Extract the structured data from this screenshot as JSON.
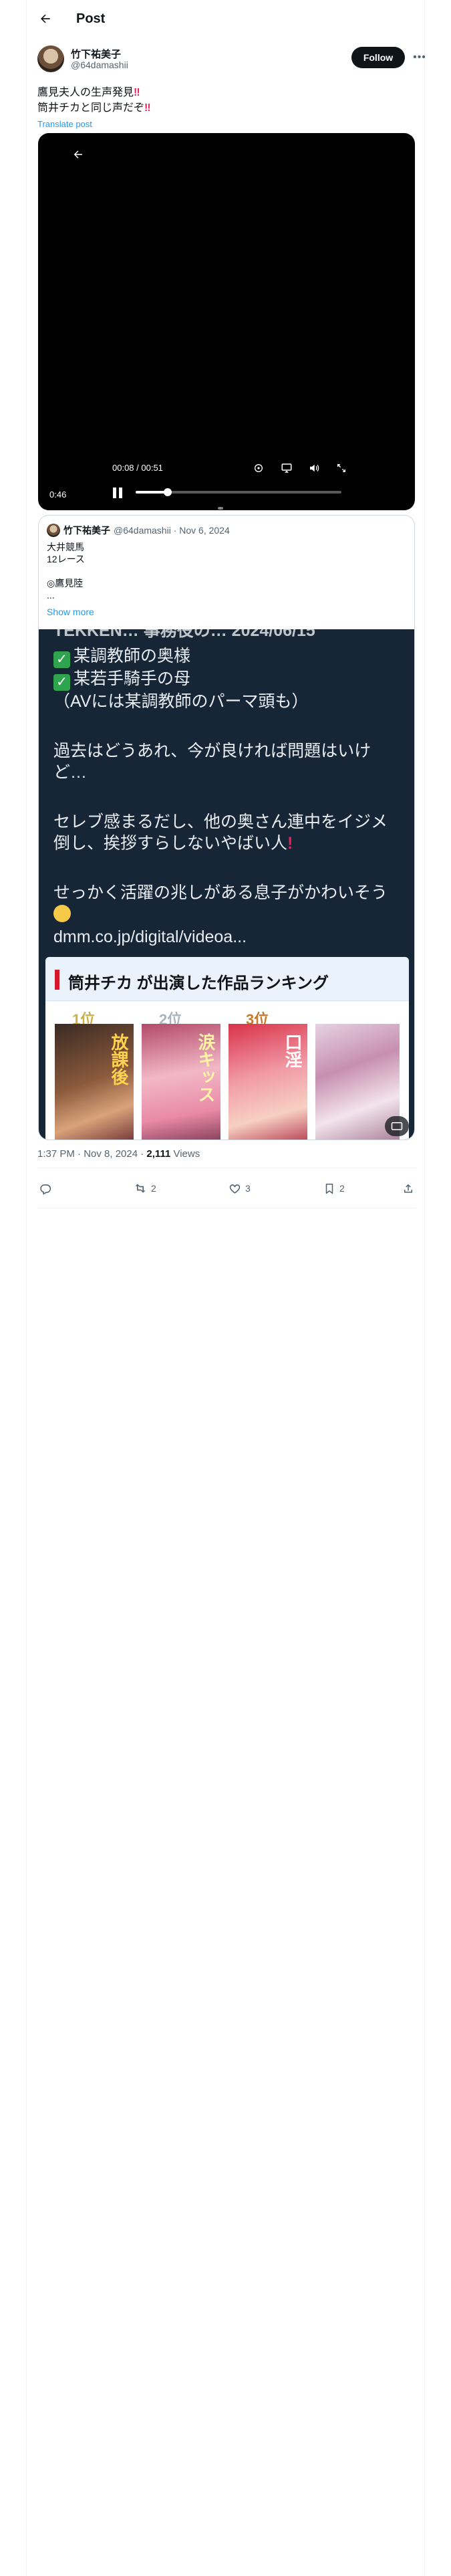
{
  "header": {
    "title": "Post"
  },
  "author": {
    "name": "竹下祐美子",
    "handle": "@64damashii",
    "follow_label": "Follow"
  },
  "post": {
    "line1": "鷹見夫人の生声発見",
    "line1_mark": "‼",
    "line2": "筒井チカと同じ声だぞ",
    "line2_mark": "‼",
    "translate_label": "Translate post"
  },
  "video": {
    "time_readout": "00:08 / 00:51",
    "elapsed": "0:46",
    "progress": 0.157
  },
  "quote": {
    "author_name": "竹下祐美子",
    "author_meta": "@64damashii · Nov 6, 2024",
    "lines": [
      "大井競馬",
      "12レース",
      "",
      "◎鷹見陸",
      "..."
    ],
    "show_more": "Show more",
    "image": {
      "partial_top": "TEKKEN… 事務役の… 2024/06/15",
      "check1": "某調教師の奥様",
      "check2": "某若手騎手の母",
      "paren": "（AVには某調教師のパーマ頭も）",
      "para1a": "過去はどうあれ、今が良ければ問題はいけ",
      "para1b": "ど…",
      "para2a": "セレブ感まるだし、他の奥さん連中をイジメ",
      "para2b": "倒し、挨拶すらしないやばい人",
      "para3": "せっかく活躍の兆しがある息子がかわいそう",
      "link": "dmm.co.jp/digital/videoa...",
      "ranking_title": "筒井チカ が出演した作品ランキング",
      "covers": [
        {
          "rank": "1位",
          "title": "放課後"
        },
        {
          "rank": "2位",
          "title": "涙キッス"
        },
        {
          "rank": "3位",
          "title": "口淫"
        },
        {
          "rank": "",
          "title": ""
        }
      ]
    }
  },
  "meta": {
    "time": "1:37 PM · Nov 8, 2024 · ",
    "views_count": "2,111",
    "views_label": " Views"
  },
  "actions": {
    "replies": "",
    "reposts": "2",
    "likes": "3",
    "bookmarks": "2"
  }
}
